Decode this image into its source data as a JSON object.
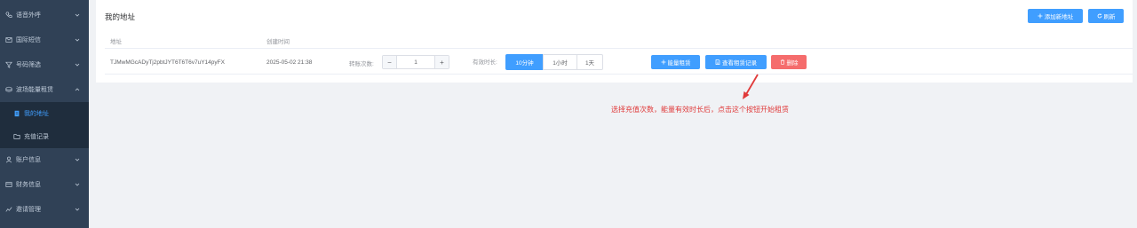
{
  "sidebar": {
    "items": [
      {
        "label": "语音外呼",
        "icon": "phone-icon",
        "expanded": false
      },
      {
        "label": "国际短信",
        "icon": "mail-icon",
        "expanded": false
      },
      {
        "label": "号码筛选",
        "icon": "filter-icon",
        "expanded": false
      },
      {
        "label": "波场能量租赁",
        "icon": "coins-icon",
        "expanded": true
      },
      {
        "label": "账户信息",
        "icon": "user-icon",
        "expanded": false
      },
      {
        "label": "财务信息",
        "icon": "wallet-icon",
        "expanded": false
      },
      {
        "label": "邀请管理",
        "icon": "share-icon",
        "expanded": false
      }
    ],
    "sub_items": [
      {
        "label": "我的地址",
        "icon": "list-icon",
        "active": true
      },
      {
        "label": "充值记录",
        "icon": "folder-icon",
        "active": false
      }
    ]
  },
  "card": {
    "title": "我的地址",
    "add_button": "添加新地址",
    "refresh_button": "刷新"
  },
  "table": {
    "headers": [
      "地址",
      "创建时间"
    ],
    "rows": [
      {
        "address": "TJMwMGcADyTj2pbtJYT6T6T6v7uY14pyFX",
        "created": "2025-05-02 21:38",
        "transfer_label": "转账次数:",
        "transfer_count": "1",
        "duration_label": "有效时长:",
        "durations": [
          "10分钟",
          "1小时",
          "1天"
        ],
        "selected_duration": "10分钟",
        "rent_button": "能量租赁",
        "records_button": "查看租赁记录",
        "delete_button": "删除"
      }
    ]
  },
  "stepper": {
    "minus": "−",
    "plus": "+"
  },
  "hint": "选择充值次数，能量有效时长后，点击这个按钮开始租赁",
  "colors": {
    "sidebar": "#304156",
    "primary": "#409eff",
    "danger": "#f56c6c",
    "hint": "#e03a3a"
  }
}
